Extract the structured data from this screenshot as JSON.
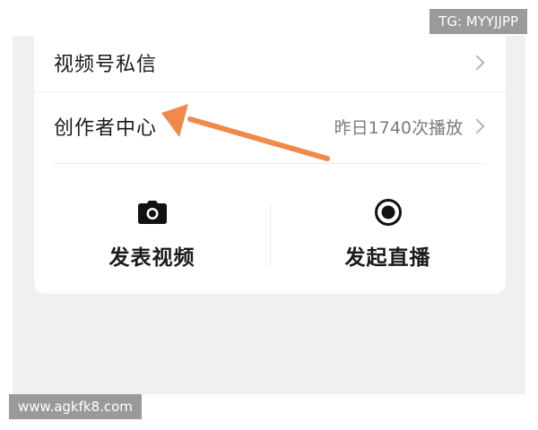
{
  "menu": {
    "channels_messages_label": "视频号私信",
    "creator_center_label": "创作者中心",
    "creator_center_stat": "昨日1740次播放"
  },
  "actions": {
    "post_video_label": "发表视频",
    "post_video_icon": "camera-icon",
    "start_live_label": "发起直播",
    "start_live_icon": "record-icon"
  },
  "annotation": {
    "arrow_color": "#f08a4b"
  },
  "watermarks": {
    "top_right": "TG: MYYJJPP",
    "bottom_left": "www.agkfk8.com"
  }
}
